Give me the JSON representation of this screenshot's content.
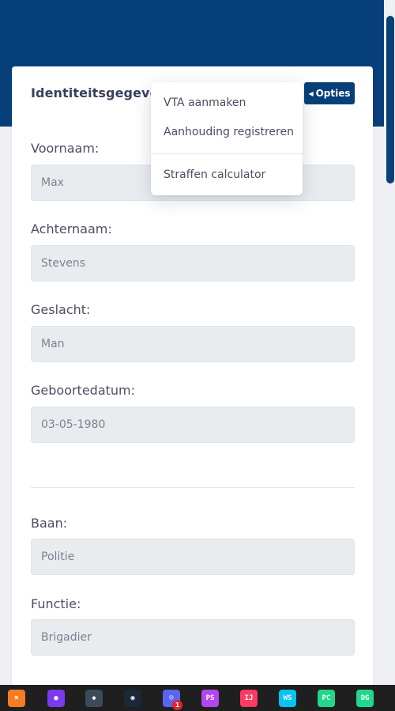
{
  "card": {
    "title": "Identiteitsgegevens",
    "options_label": "Opties"
  },
  "menu": {
    "items": [
      "VTA aanmaken",
      "Aanhouding registreren",
      "Straffen calculator"
    ]
  },
  "fields": {
    "voornaam": {
      "label": "Voornaam:",
      "value": "Max"
    },
    "achternaam": {
      "label": "Achternaam:",
      "value": "Stevens"
    },
    "geslacht": {
      "label": "Geslacht:",
      "value": "Man"
    },
    "geboortedatum": {
      "label": "Geboortedatum:",
      "value": "03-05-1980"
    },
    "baan": {
      "label": "Baan:",
      "value": "Politie"
    },
    "functie": {
      "label": "Functie:",
      "value": "Brigadier"
    }
  },
  "taskbar": {
    "icons": [
      {
        "name": "xampp-icon",
        "text": "✖",
        "color": "#f67c22"
      },
      {
        "name": "github-icon",
        "text": "●",
        "color": "#7c3aed"
      },
      {
        "name": "git-icon",
        "text": "◆",
        "color": "#3b4b5c"
      },
      {
        "name": "steam-icon",
        "text": "◉",
        "color": "#1b2838"
      },
      {
        "name": "discord-icon",
        "text": "☺",
        "color": "#5865f2",
        "badge": "1"
      },
      {
        "name": "phpstorm-icon",
        "text": "PS",
        "color": "#b345f1"
      },
      {
        "name": "intellij-icon",
        "text": "IJ",
        "color": "#fc3a64"
      },
      {
        "name": "webstorm-icon",
        "text": "WS",
        "color": "#07c3f2"
      },
      {
        "name": "pycharm-icon",
        "text": "PC",
        "color": "#21d789"
      },
      {
        "name": "datagrip-icon",
        "text": "DG",
        "color": "#22d88f"
      }
    ]
  },
  "colors": {
    "header": "#063f7a",
    "input_bg": "#e9ecef"
  }
}
